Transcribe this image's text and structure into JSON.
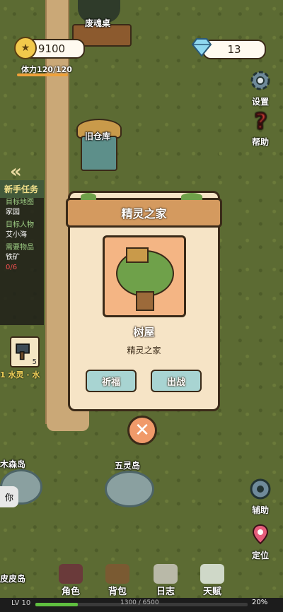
{
  "currency": {
    "coins": "9100",
    "gems": "13"
  },
  "stamina": {
    "label": "体力120/120",
    "fraction": 1.0
  },
  "side": {
    "settings": "设置",
    "help": "帮助",
    "assist": "辅助",
    "locate": "定位"
  },
  "map": {
    "discard_table": "废魂桌",
    "old_warehouse": "旧仓库",
    "wood_forest_island": "木森岛",
    "five_spirit_island": "五灵岛",
    "pipi_island": "皮皮岛",
    "chat_stub": "你"
  },
  "quest": {
    "title": "新手任务",
    "map_key": "目标地图",
    "map_val": "家园",
    "person_key": "目标人物",
    "person_val": "艾小海",
    "item_key": "需要物品",
    "item_val": "铁矿",
    "progress": "0/6"
  },
  "item_slot": {
    "count": "5"
  },
  "sprite_label": "1 水灵 · 水",
  "modal": {
    "title": "精灵之家",
    "building_name": "树屋",
    "building_desc": "精灵之家",
    "bless_label": "祈福",
    "fight_label": "出战"
  },
  "nav": {
    "role": "角色",
    "bag": "背包",
    "log": "日志",
    "talent": "天赋"
  },
  "level": {
    "label": "LV 10",
    "exp": "1300 / 6500",
    "percent": "20%",
    "fraction": 0.2
  }
}
